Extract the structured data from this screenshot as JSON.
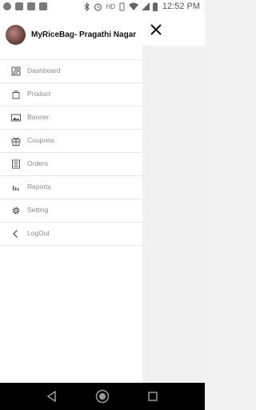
{
  "status_bar": {
    "time": "12:52 PM",
    "network": "HD",
    "notification_icons": [
      "browser-icon",
      "app-notification-icon",
      "mail-icon",
      "image-icon"
    ],
    "system_icons": [
      "bluetooth-icon",
      "alarm-icon",
      "vibrate-icon",
      "wifi-icon",
      "signal-icon",
      "battery-icon"
    ]
  },
  "drawer": {
    "store_name": "MyRiceBag- Pragathi Nagar",
    "items": [
      {
        "label": "Dashboard",
        "icon": "dashboard-icon"
      },
      {
        "label": "Product",
        "icon": "shopping-bag-icon"
      },
      {
        "label": "Banner",
        "icon": "image-icon"
      },
      {
        "label": "Coupons",
        "icon": "gift-icon"
      },
      {
        "label": "Orders",
        "icon": "orders-list-icon"
      },
      {
        "label": "Reports",
        "icon": "bar-chart-icon"
      },
      {
        "label": "Setting",
        "icon": "gear-icon"
      },
      {
        "label": "LogOut",
        "icon": "chevron-left-icon"
      }
    ]
  },
  "navigation_bar": {
    "buttons": [
      "back",
      "home",
      "recents"
    ]
  },
  "colors": {
    "edge_accent": "#8bc34a",
    "menu_text": "#8a8a8a",
    "title_text": "#111111"
  }
}
